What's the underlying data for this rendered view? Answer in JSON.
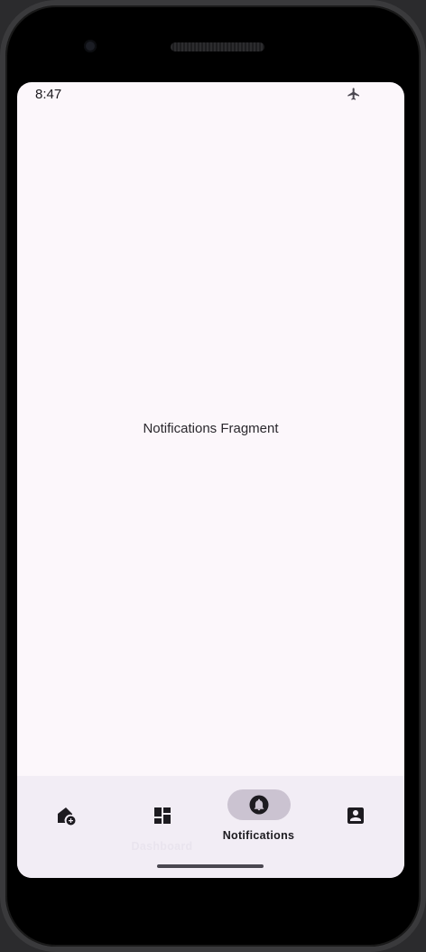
{
  "status_bar": {
    "time": "8:47",
    "airplane_icon": "airplane-icon"
  },
  "content": {
    "fragment_text": "Notifications Fragment"
  },
  "bottom_nav": {
    "items": [
      {
        "id": "home",
        "icon": "home-add-icon",
        "label": "",
        "active": false
      },
      {
        "id": "dashboard",
        "icon": "dashboard-icon",
        "label": "Dashboard",
        "active": false
      },
      {
        "id": "notifications",
        "icon": "bell-icon",
        "label": "Notifications",
        "active": true
      },
      {
        "id": "profile",
        "icon": "account-box-icon",
        "label": "",
        "active": false
      }
    ]
  },
  "colors": {
    "screen_background": "#fcf7fb",
    "nav_background": "#f2edf5",
    "active_indicator": "#cbc3d1",
    "icon": "#1d1b20"
  }
}
